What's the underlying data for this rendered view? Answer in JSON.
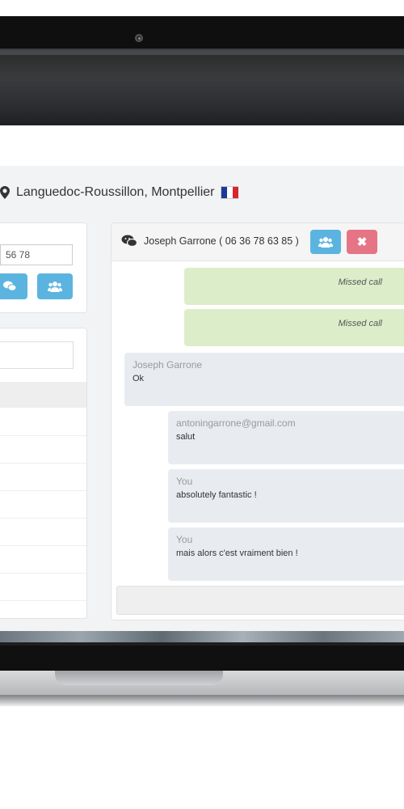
{
  "header": {
    "location_text": "Languedoc-Roussillon, Montpellier",
    "flag_colors": [
      "#1a3a9c",
      "#ffffff",
      "#d9242b"
    ]
  },
  "left_panel": {
    "phone_value": "56 78"
  },
  "chat": {
    "title": "Joseph Garrone ( 06 36 78 63 85 )",
    "messages": [
      {
        "type": "out",
        "text": "Missed call"
      },
      {
        "type": "out",
        "text": "Missed call"
      },
      {
        "type": "in",
        "sender": "Joseph Garrone",
        "text": "Ok"
      },
      {
        "type": "in",
        "sender": "antoningarrone@gmail.com",
        "text": "salut"
      },
      {
        "type": "in",
        "sender": "You",
        "text": "absolutely fantastic !"
      },
      {
        "type": "in",
        "sender": "You",
        "text": "mais alors c'est vraiment bien !"
      }
    ]
  },
  "colors": {
    "accent_blue": "#5bb4e0",
    "accent_red": "#e57485",
    "outgoing_bubble": "#dceec9",
    "incoming_bubble": "#e8ecf1"
  }
}
